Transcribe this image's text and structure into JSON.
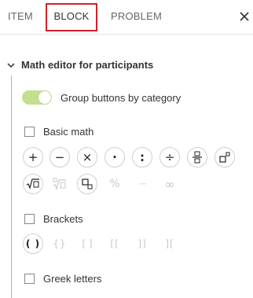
{
  "tabs": [
    {
      "label": "ITEM"
    },
    {
      "label": "BLOCK"
    },
    {
      "label": "PROBLEM"
    }
  ],
  "section": {
    "title": "Math editor for participants"
  },
  "toggle": {
    "label": "Group buttons by category",
    "on": true
  },
  "groups": {
    "basic_math": {
      "label": "Basic math",
      "checked": false,
      "buttons": [
        {
          "glyph": "+",
          "icon": "plus-icon",
          "enabled": true
        },
        {
          "glyph": "−",
          "icon": "minus-icon",
          "enabled": true
        },
        {
          "glyph": "×",
          "icon": "times-icon",
          "enabled": true
        },
        {
          "glyph": "·",
          "icon": "dot-icon",
          "enabled": true
        },
        {
          "glyph": ":",
          "icon": "colon-icon",
          "enabled": true
        },
        {
          "glyph": "÷",
          "icon": "divide-icon",
          "enabled": true
        },
        {
          "glyph": "",
          "icon": "fraction-icon",
          "enabled": true
        },
        {
          "glyph": "",
          "icon": "superscript-icon",
          "enabled": true
        },
        {
          "glyph": "",
          "icon": "square-root-icon",
          "enabled": true
        },
        {
          "glyph": "",
          "icon": "nth-root-icon",
          "enabled": false
        },
        {
          "glyph": "",
          "icon": "subscript-icon",
          "enabled": true
        },
        {
          "glyph": "%",
          "icon": "percent-icon",
          "enabled": false
        },
        {
          "glyph": "···",
          "icon": "ellipsis-icon",
          "enabled": false
        },
        {
          "glyph": "∞",
          "icon": "infinity-icon",
          "enabled": false
        }
      ]
    },
    "brackets": {
      "label": "Brackets",
      "checked": false,
      "buttons": [
        {
          "glyph": "( )",
          "icon": "parentheses-icon",
          "enabled": true
        },
        {
          "glyph": "{}",
          "icon": "curly-braces-icon",
          "enabled": false
        },
        {
          "glyph": "[ ]",
          "icon": "square-brackets-icon",
          "enabled": false
        },
        {
          "glyph": "[[",
          "icon": "left-brackets-icon",
          "enabled": false
        },
        {
          "glyph": "]]",
          "icon": "right-brackets-icon",
          "enabled": false
        },
        {
          "glyph": "][",
          "icon": "reversed-brackets-icon",
          "enabled": false
        }
      ]
    },
    "greek": {
      "label": "Greek letters",
      "checked": false
    }
  },
  "colors": {
    "accent_green": "#a6cf4b",
    "toggle_on": "#c3df8f",
    "highlight_red": "#d0202a"
  }
}
